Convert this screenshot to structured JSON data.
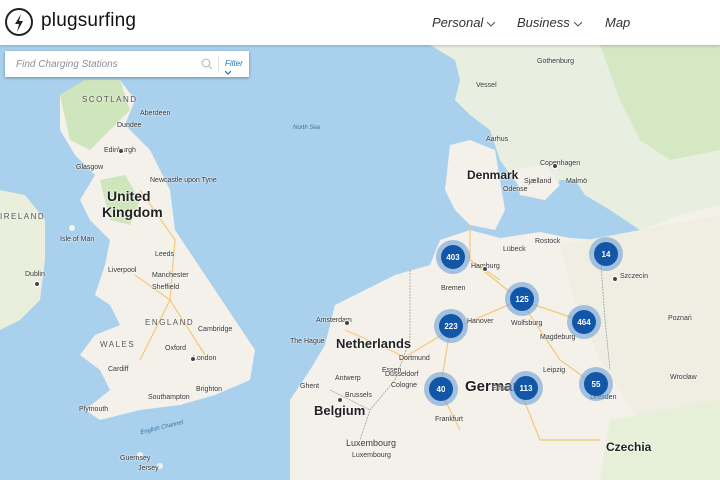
{
  "header": {
    "brand": "plugsurfing",
    "nav": [
      {
        "label": "Personal",
        "has_dropdown": true
      },
      {
        "label": "Business",
        "has_dropdown": true
      },
      {
        "label": "Map",
        "has_dropdown": false
      }
    ]
  },
  "search": {
    "placeholder": "Find Charging Stations",
    "filter_label": "Filter"
  },
  "map": {
    "countries": [
      "United",
      "Kingdom",
      "Netherlands",
      "Belgium",
      "Luxembourg",
      "Denmark",
      "Germany",
      "Czechia",
      "IRELAND"
    ],
    "regions": [
      "SCOTLAND",
      "ENGLAND",
      "WALES"
    ],
    "water": [
      "North Sea",
      "English Channel"
    ],
    "cities": [
      "Gothenburg",
      "Vessel",
      "Aberdeen",
      "Dundee",
      "Edinburgh",
      "Glasgow",
      "Newcastle upon Tyne",
      "Isle of Man",
      "Leeds",
      "Liverpool",
      "Manchester",
      "Sheffield",
      "Cambridge",
      "Oxford",
      "London",
      "Brighton",
      "Southampton",
      "Plymouth",
      "Dublin",
      "Cardiff",
      "Copenhagen",
      "Malmö",
      "Odense",
      "Aarhus",
      "Lübeck",
      "Hamburg",
      "Bremen",
      "Hanover",
      "Wolfsburg",
      "Magdeburg",
      "Rostock",
      "Szczecin",
      "Poznań",
      "Amsterdam",
      "The Hague",
      "Dortmund",
      "Essen",
      "Antwerp",
      "Brussels",
      "Ghent",
      "Cologne",
      "Düsseldorf",
      "Frankfurt",
      "Leipzig",
      "Dresden",
      "Wrocław",
      "Erfurt",
      "Luxembourg",
      "Guernsey",
      "Jersey",
      "Sjælland"
    ],
    "clusters": [
      {
        "count": "403"
      },
      {
        "count": "14"
      },
      {
        "count": "125"
      },
      {
        "count": "223"
      },
      {
        "count": "464"
      },
      {
        "count": "40"
      },
      {
        "count": "113"
      },
      {
        "count": "55"
      }
    ]
  },
  "colors": {
    "sea": "#a9d1ee",
    "land": "#f3f1ea",
    "green_land": "#c9e4b4",
    "cluster": "#1256a8",
    "brand_text": "#111111",
    "filter_link": "#1a73c8"
  }
}
